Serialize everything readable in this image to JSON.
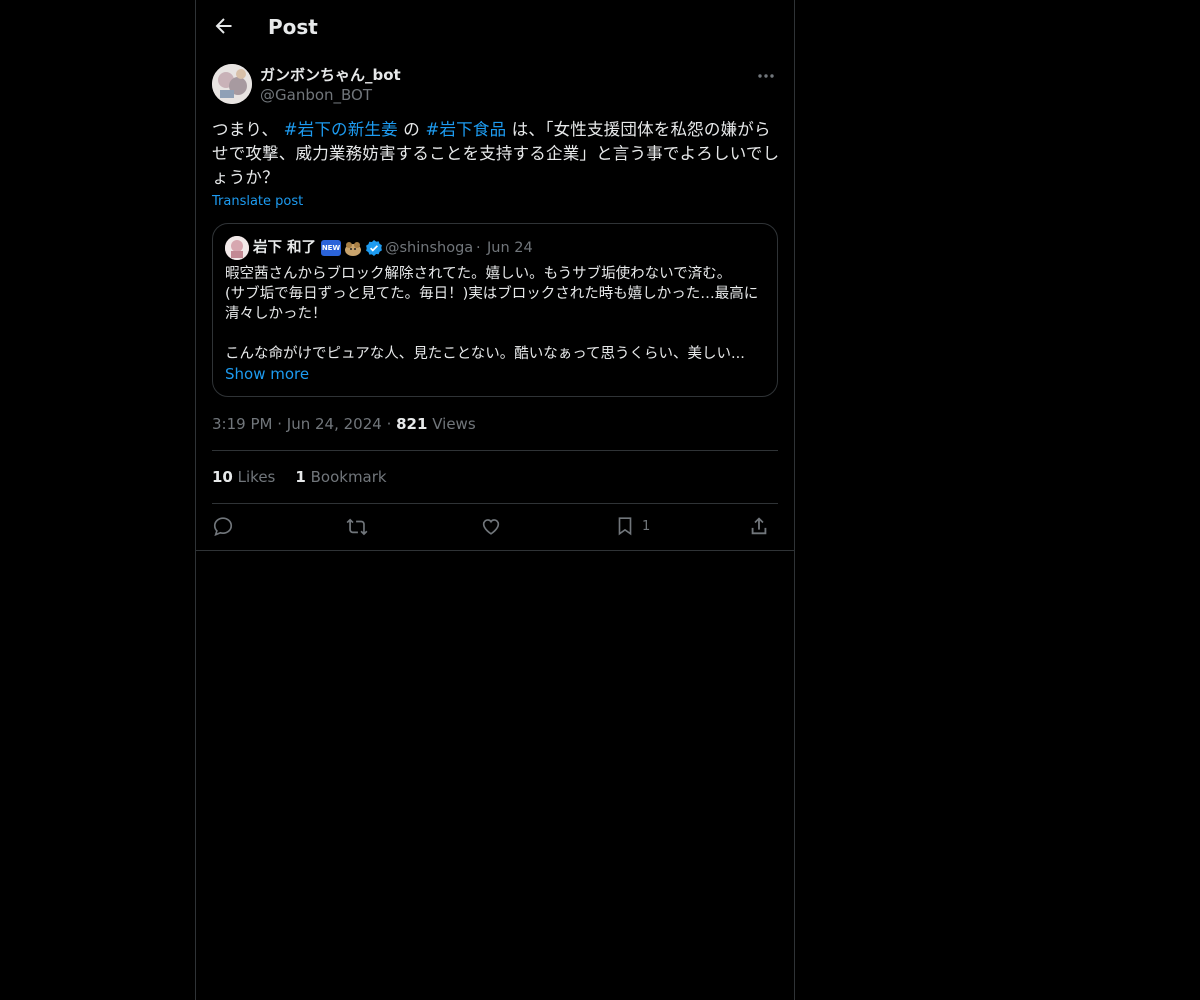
{
  "header": {
    "title": "Post"
  },
  "post": {
    "author_name": "ガンボンちゃん_bot",
    "author_handle": "@Ganbon_BOT",
    "text_parts": [
      "つまり、",
      "#岩下の新生姜",
      "の",
      "#岩下食品",
      "は、「女性支援団体を私怨の嫌がらせで攻撃、威力業務妨害することを支持する企業」と言う事でよろしいでしょうか？"
    ],
    "translate_label": "Translate post",
    "time": "3:19 PM",
    "date": "Jun 24, 2024",
    "views_count": "821",
    "views_label": "Views",
    "likes_count": "10",
    "likes_label": "Likes",
    "bookmarks_count": "1",
    "bookmarks_label": "Bookmark",
    "action_bookmark_count": "1"
  },
  "quote": {
    "author_name": "岩下 和了",
    "badge_new": "NEW",
    "author_handle": "@shinshoga",
    "date": "Jun 24",
    "text": "暇空茜さんからブロック解除されてた。嬉しい。もうサブ垢使わないで済む。\n(サブ垢で毎日ずっと見てた。毎日！)実はブロックされた時も嬉しかった…最高に清々しかった！\n\nこんな命がけでピュアな人、見たことない。酷いなぁって思うくらい、美しい...",
    "show_more": "Show more"
  },
  "colors": {
    "accent": "#1d9bf0",
    "text": "#e7e9ea",
    "muted": "#71767b",
    "border": "#2f3336",
    "background": "#000000"
  },
  "icons": [
    "back-arrow-icon",
    "more-icon",
    "verified-icon",
    "reply-icon",
    "repost-icon",
    "like-icon",
    "bookmark-icon",
    "share-icon"
  ]
}
